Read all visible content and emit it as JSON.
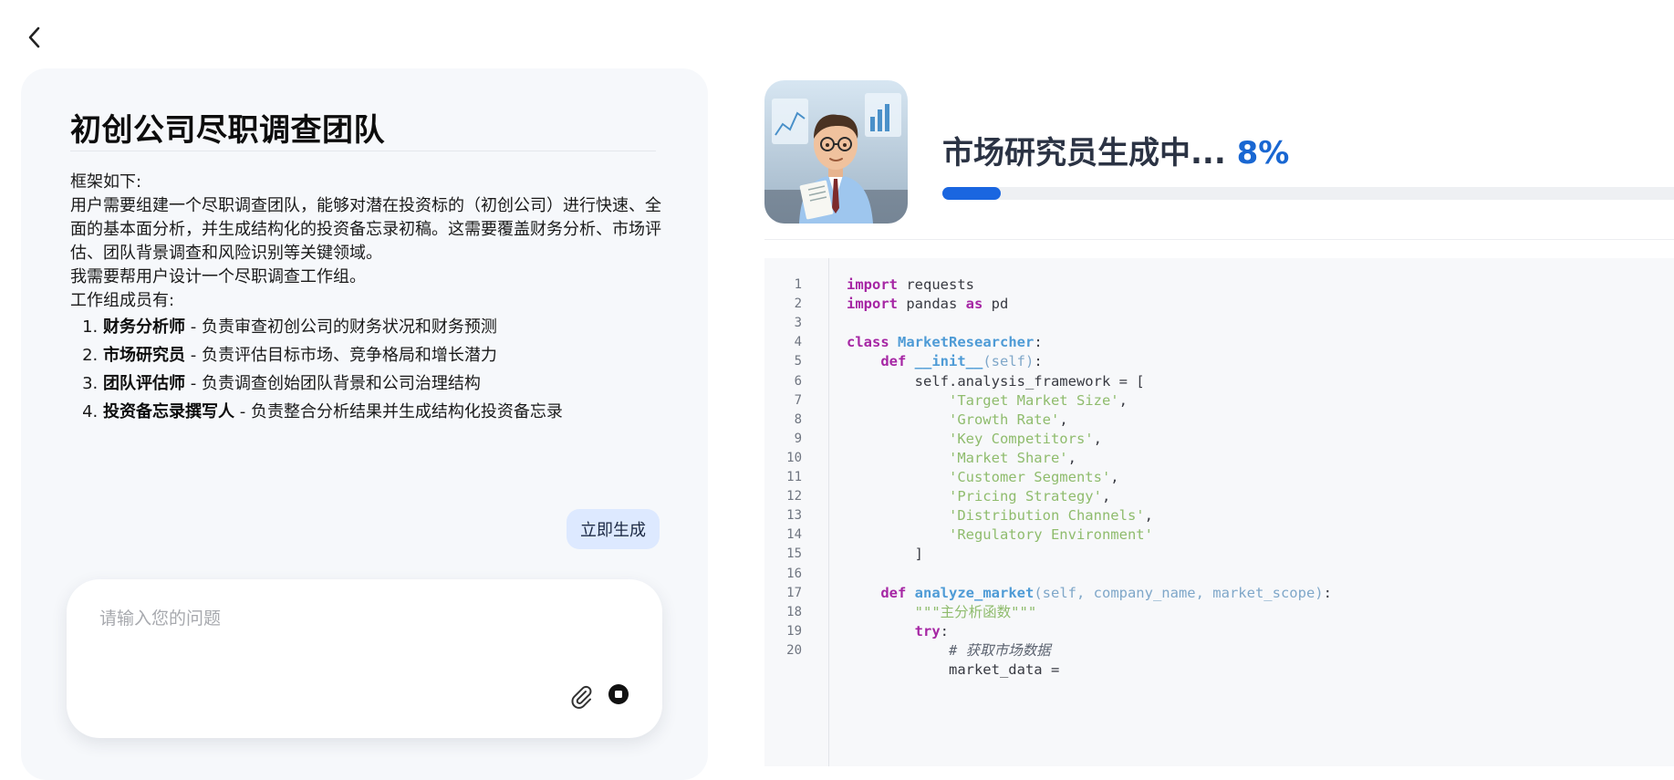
{
  "nav": {
    "back_icon": "chevron-left-icon"
  },
  "left": {
    "title": "初创公司尽职调查团队",
    "description": {
      "framework_label": "框架如下:",
      "paragraph": "用户需要组建一个尽职调查团队，能够对潜在投资标的（初创公司）进行快速、全面的基本面分析，并生成结构化的投资备忘录初稿。这需要覆盖财务分析、市场评估、团队背景调查和风险识别等关键领域。",
      "task": "我需要帮用户设计一个尽职调查工作组。",
      "members_label": "工作组成员有:",
      "members": [
        {
          "name": "财务分析师",
          "desc": " - 负责审查初创公司的财务状况和财务预测"
        },
        {
          "name": "市场研究员",
          "desc": " - 负责评估目标市场、竞争格局和增长潜力"
        },
        {
          "name": "团队评估师",
          "desc": " - 负责调查创始团队背景和公司治理结构"
        },
        {
          "name": "投资备忘录撰写人",
          "desc": " - 负责整合分析结果并生成结构化投资备忘录"
        }
      ]
    },
    "generate_button": "立即生成",
    "input": {
      "placeholder": "请输入您的问题",
      "value": "",
      "attach_icon": "paperclip-icon",
      "stop_icon": "stop-icon"
    }
  },
  "right": {
    "avatar_alt": "市场研究员",
    "status_text": "市场研究员生成中...",
    "percent_text": "8%",
    "progress": 0.08,
    "code_lines": [
      {
        "n": "1",
        "text": "import requests"
      },
      {
        "n": "2",
        "text": "import pandas as pd"
      },
      {
        "n": "3",
        "text": ""
      },
      {
        "n": "4",
        "text": "class MarketResearcher:"
      },
      {
        "n": "5",
        "text": "    def __init__(self):"
      },
      {
        "n": "6",
        "text": "        self.analysis_framework = ["
      },
      {
        "n": "7",
        "text": "            'Target Market Size',"
      },
      {
        "n": "8",
        "text": "            'Growth Rate',"
      },
      {
        "n": "9",
        "text": "            'Key Competitors',"
      },
      {
        "n": "10",
        "text": "            'Market Share',"
      },
      {
        "n": "11",
        "text": "            'Customer Segments',"
      },
      {
        "n": "12",
        "text": "            'Pricing Strategy',"
      },
      {
        "n": "13",
        "text": "            'Distribution Channels',"
      },
      {
        "n": "14",
        "text": "            'Regulatory Environment'"
      },
      {
        "n": "15",
        "text": "        ]"
      },
      {
        "n": "16",
        "text": ""
      },
      {
        "n": "17",
        "text": "    def analyze_market(self, company_name, market_scope):"
      },
      {
        "n": "18",
        "text": "        \"\"\"主分析函数\"\"\""
      },
      {
        "n": "19",
        "text": "        try:"
      },
      {
        "n": "20",
        "text": "            # 获取市场数据"
      },
      {
        "n": "",
        "text": "            market_data ="
      }
    ]
  }
}
